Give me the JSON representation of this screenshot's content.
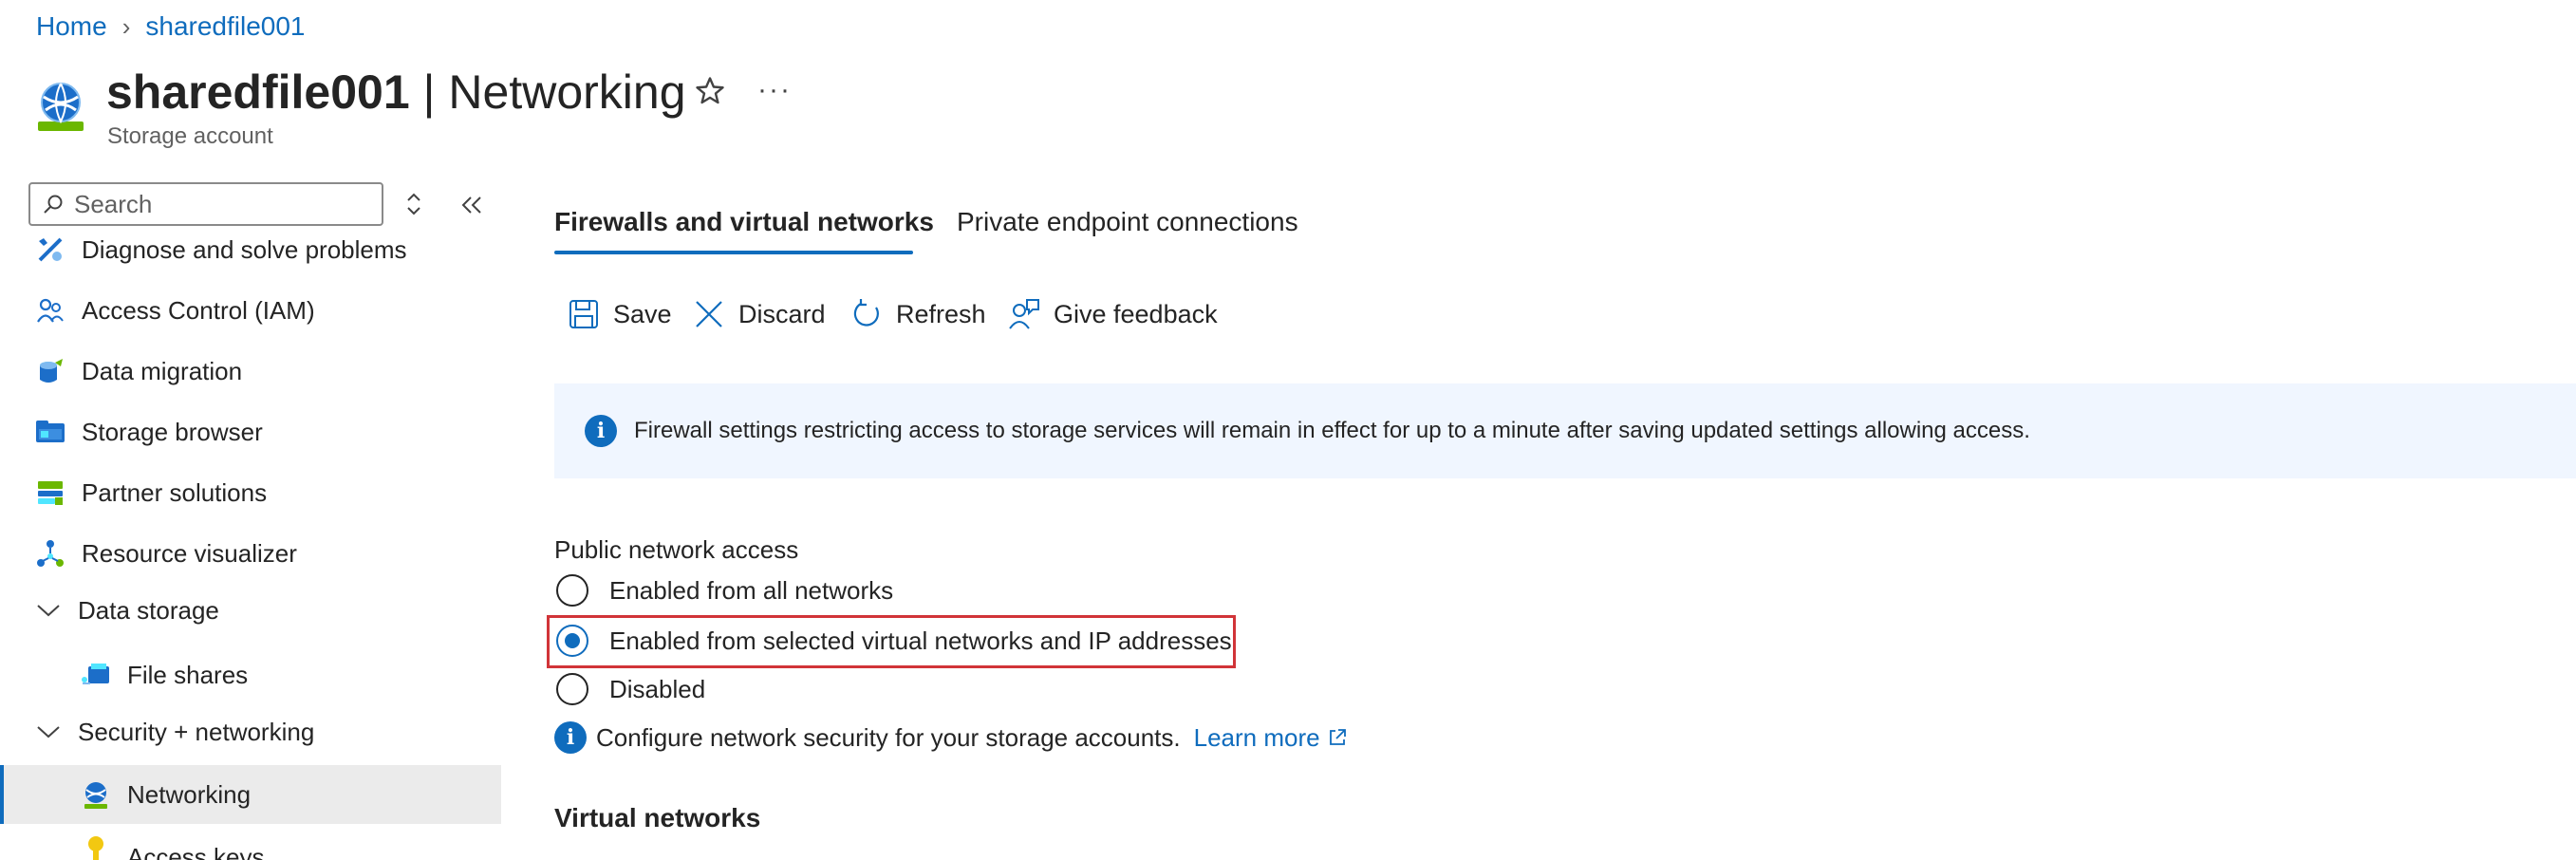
{
  "breadcrumb": {
    "home": "Home",
    "separator": "›",
    "resource": "sharedfile001"
  },
  "header": {
    "resource_name": "sharedfile001",
    "title_separator": " | ",
    "page_name": "Networking",
    "subtitle": "Storage account",
    "more": "···"
  },
  "sidebar": {
    "search_placeholder": "Search",
    "items": [
      {
        "label": "Diagnose and solve problems",
        "icon": "wrench-icon"
      },
      {
        "label": "Access Control (IAM)",
        "icon": "people-icon"
      },
      {
        "label": "Data migration",
        "icon": "data-migration-icon"
      },
      {
        "label": "Storage browser",
        "icon": "storage-browser-icon"
      },
      {
        "label": "Partner solutions",
        "icon": "partner-icon"
      },
      {
        "label": "Resource visualizer",
        "icon": "hierarchy-icon"
      },
      {
        "label": "Data storage",
        "icon": "chevron-down-icon"
      },
      {
        "label": "File shares",
        "icon": "file-share-icon"
      },
      {
        "label": "Security + networking",
        "icon": "chevron-down-icon"
      },
      {
        "label": "Networking",
        "icon": "globe-icon"
      },
      {
        "label": "Access keys",
        "icon": "key-icon"
      }
    ]
  },
  "tabs": [
    {
      "label": "Firewalls and virtual networks",
      "active": true
    },
    {
      "label": "Private endpoint connections",
      "active": false
    }
  ],
  "toolbar": {
    "save": "Save",
    "discard": "Discard",
    "refresh": "Refresh",
    "feedback": "Give feedback"
  },
  "banner": {
    "text": "Firewall settings restricting access to storage services will remain in effect for up to a minute after saving updated settings allowing access."
  },
  "public_access": {
    "label": "Public network access",
    "options": [
      {
        "label": "Enabled from all networks",
        "selected": false
      },
      {
        "label": "Enabled from selected virtual networks and IP addresses",
        "selected": true
      },
      {
        "label": "Disabled",
        "selected": false
      }
    ],
    "configure_text": "Configure network security for your storage accounts.",
    "learn_more": "Learn more"
  },
  "virtual_networks": {
    "heading": "Virtual networks"
  },
  "colors": {
    "accent": "#0f6cbd",
    "highlight_border": "#d13438",
    "banner_bg": "#f0f6ff",
    "active_nav_bg": "#ebebeb"
  }
}
